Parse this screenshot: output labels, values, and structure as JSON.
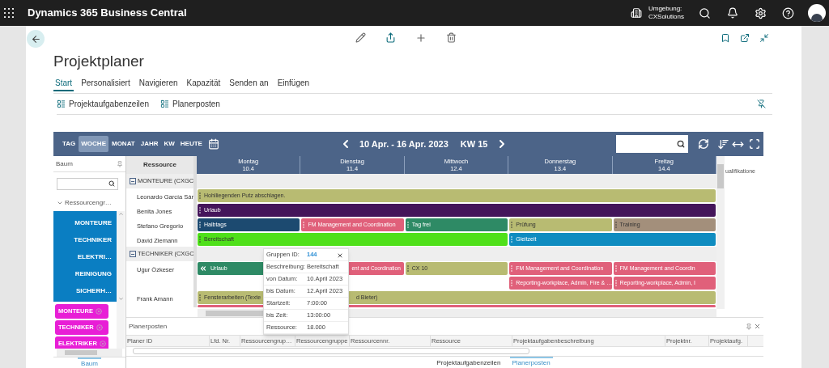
{
  "top_bar": {
    "app_title": "Dynamics 365 Business Central",
    "environment_label": "Umgebung:",
    "environment_name": "CXSolutions"
  },
  "page": {
    "title": "Projektplaner",
    "tabs": [
      {
        "label": "Start",
        "selected": true
      },
      {
        "label": "Personalisiert",
        "selected": false
      },
      {
        "label": "Navigieren",
        "selected": false
      },
      {
        "label": "Kapazität",
        "selected": false
      },
      {
        "label": "Senden an",
        "selected": false
      },
      {
        "label": "Einfügen",
        "selected": false
      }
    ],
    "actions": [
      "Projektaufgabenzeilen",
      "Planerposten"
    ]
  },
  "planner": {
    "view_buttons": [
      {
        "label": "TAG",
        "selected": false
      },
      {
        "label": "WOCHE",
        "selected": true
      },
      {
        "label": "MONAT",
        "selected": false
      },
      {
        "label": "JAHR",
        "selected": false
      },
      {
        "label": "KW",
        "selected": false
      },
      {
        "label": "HEUTE",
        "selected": false
      }
    ],
    "date_range": "10 Apr. - 16 Apr. 2023",
    "week": "KW 15",
    "tree": {
      "header": "Baum",
      "root": "Ressourcengr…",
      "items": [
        "MONTEURE",
        "TECHNIKER",
        "ELEKTRI…",
        "REINIGUNG",
        "SICHERH…"
      ],
      "tags": [
        "MONTEURE",
        "TECHNIKER",
        "ELEKTRIKER"
      ],
      "tab": "Baum"
    },
    "resource_header": "Ressource",
    "days": [
      {
        "name": "Montag",
        "date": "10.4"
      },
      {
        "name": "Dienstag",
        "date": "11.4"
      },
      {
        "name": "Mittwoch",
        "date": "12.4"
      },
      {
        "name": "Donnerstag",
        "date": "13.4"
      },
      {
        "name": "Freitag",
        "date": "14.4"
      }
    ],
    "side_panel": "ualifikatione",
    "groups": [
      {
        "name": "MONTEURE (CXGC",
        "expanded": true,
        "resources": [
          {
            "name": "Leonardo García Sár",
            "lanes": [
              [
                {
                  "label": "Hohlliegenden Putz abschlagen.",
                  "color": "#b8bb72"
                }
              ]
            ]
          },
          {
            "name": "Benita Jones",
            "lanes": [
              [
                {
                  "label": "Urlaub",
                  "color": "#44155a"
                }
              ]
            ]
          },
          {
            "name": "Stefano Gregorio",
            "lanes": [
              [
                {
                  "label": "Halbtags",
                  "color": "#1c4a70"
                },
                {
                  "label": "FM Management and Coordination",
                  "color": "#e0607a"
                },
                {
                  "label": "Tag frei",
                  "color": "#2e8a65"
                },
                {
                  "label": "Prüfung",
                  "color": "#b8bb72"
                },
                {
                  "label": "Training",
                  "color": "#a38f7b"
                }
              ]
            ]
          },
          {
            "name": "David Ziemann",
            "lanes": [
              [
                {
                  "label": "Bereitschaft",
                  "color": "#4fe01a"
                },
                {
                  "label": "Gleitzeit",
                  "color": "#0f8cc0"
                }
              ]
            ]
          }
        ]
      },
      {
        "name": "TECHNIKER (CXGC",
        "expanded": true,
        "resources": [
          {
            "name": "Ugur Özkeser",
            "lanes": [
              [
                {
                  "label": "Urlaub",
                  "color": "#2e8a65",
                  "kind": "continued"
                },
                {
                  "label_end": "ent and Coordination",
                  "color": "#e0607a"
                },
                {
                  "label": "CX 10",
                  "color": "#b8bb72"
                },
                {
                  "label": "FM Management and Coordination",
                  "color": "#e0607a"
                },
                {
                  "label": "FM Management and Coordin",
                  "color": "#e0607a"
                }
              ],
              [
                {
                  "label": "Reporting-workplace, Admin, Fire & …",
                  "color": "#e0607a"
                },
                {
                  "label": "Reporting-workplace, Admin, I",
                  "color": "#e0607a"
                }
              ]
            ]
          },
          {
            "name": "Frank Amann",
            "lanes": [
              [
                {
                  "label": "Fensterarbeiten (Texte",
                  "label_end": "d Bieter)",
                  "color": "#b8bb72"
                }
              ]
            ]
          },
          {
            "lanes": [
              [
                {
                  "color": "#e0607a"
                }
              ]
            ]
          }
        ]
      }
    ],
    "popup": {
      "rows": [
        {
          "label": "Gruppen ID:",
          "value": "144",
          "kind": "link"
        },
        {
          "label": "Beschreibung:",
          "value": "Bereitschaft"
        },
        {
          "label": "von Datum:",
          "value": "10.April 2023"
        },
        {
          "label": "bis Datum:",
          "value": "12.April 2023"
        },
        {
          "label": "Startzeit:",
          "value": "7:00:00"
        },
        {
          "label": "bis Zeit:",
          "value": "13:00:00"
        },
        {
          "label": "Ressource:",
          "value": "18.000"
        }
      ]
    },
    "bottom_panel": {
      "title": "Planerposten",
      "columns": [
        "Planer ID",
        "Lfd. Nr.",
        "Ressourcengrup…",
        "Ressourcengruppe",
        "Ressourcennr.",
        "Ressource",
        "Projektaufgabenbeschreibung",
        "Projektnr.",
        "Projektaufg."
      ]
    },
    "bottom_tabs": [
      {
        "label": "Projektaufgabenzeilen",
        "selected": false
      },
      {
        "label": "Planerposten",
        "selected": true
      }
    ]
  }
}
